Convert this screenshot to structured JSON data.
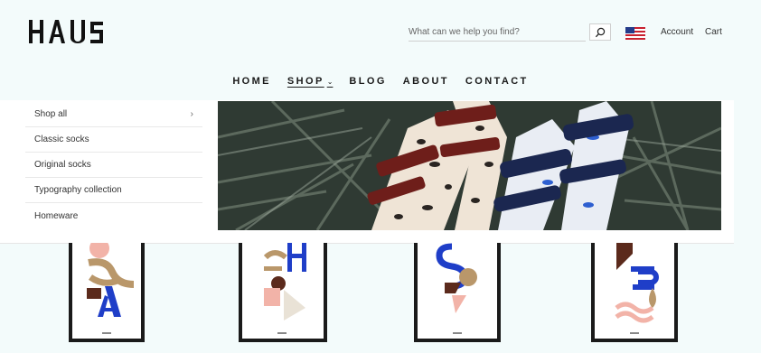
{
  "header": {
    "logo": "HAUS",
    "search_placeholder": "What can we help you find?",
    "links": [
      {
        "label": "Account"
      },
      {
        "label": "Cart"
      }
    ]
  },
  "nav": {
    "items": [
      {
        "label": "HOME"
      },
      {
        "label": "SHOP"
      },
      {
        "label": "BLOG"
      },
      {
        "label": "ABOUT"
      },
      {
        "label": "CONTACT"
      }
    ],
    "active": "SHOP",
    "caret": "⌄"
  },
  "shop_menu": {
    "items": [
      {
        "label": "Shop all",
        "arrow": "›"
      },
      {
        "label": "Classic socks"
      },
      {
        "label": "Original socks"
      },
      {
        "label": "Typography collection"
      },
      {
        "label": "Homeware"
      }
    ]
  },
  "products": {
    "poster_caption": "HAUS"
  },
  "colors": {
    "background": "#f3fbfb",
    "blue": "#1f3ec8",
    "pink": "#f2b3a8",
    "tan": "#b9976a",
    "brown": "#5b2a1c"
  }
}
